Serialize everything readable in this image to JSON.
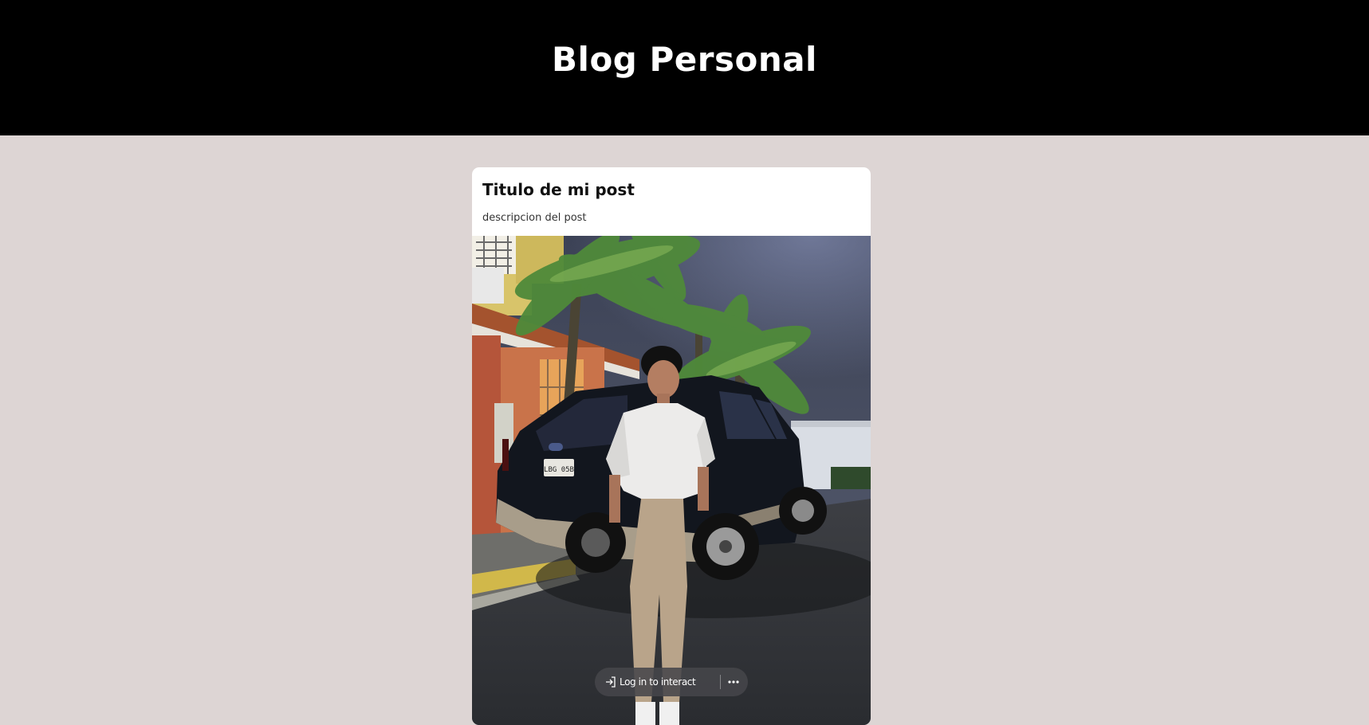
{
  "header": {
    "title": "Blog Personal"
  },
  "post": {
    "title": "Titulo de mi post",
    "description": "descripcion del post",
    "image_icon": "photo-image",
    "license_plate": "LBG 05B"
  },
  "overlay": {
    "login_label": "Log in to interact",
    "login_icon": "login-icon",
    "more_icon": "more-dots-icon"
  },
  "colors": {
    "header_bg": "#000000",
    "page_bg": "#ddd5d4",
    "card_bg": "#ffffff"
  }
}
